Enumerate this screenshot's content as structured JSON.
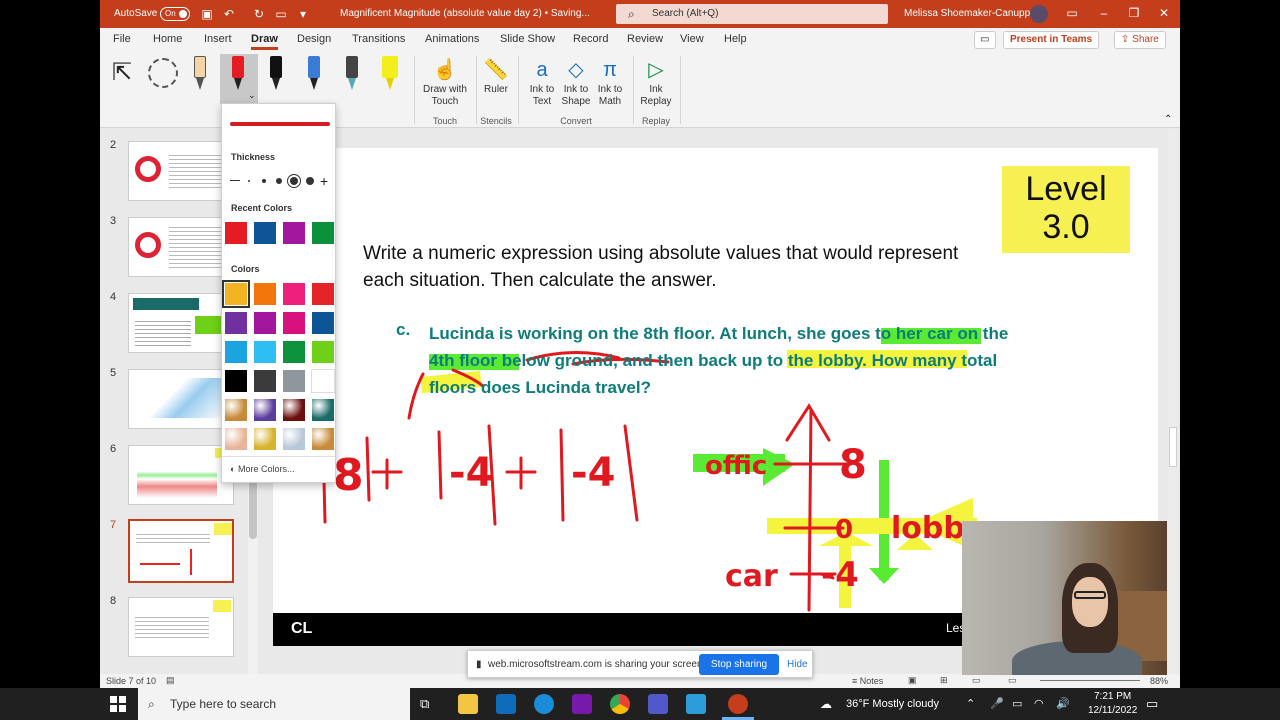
{
  "titlebar": {
    "autosave": "AutoSave",
    "autosave_state": "On",
    "doc_title": "Magnificent Magnitude (absolute value day 2) • Saving...",
    "search_placeholder": "Search (Alt+Q)",
    "user": "Melissa Shoemaker-Canupp"
  },
  "menu": {
    "tabs": [
      "File",
      "Home",
      "Insert",
      "Draw",
      "Design",
      "Transitions",
      "Animations",
      "Slide Show",
      "Record",
      "Review",
      "View",
      "Help"
    ],
    "active": "Draw",
    "present": "Present in Teams",
    "share": "Share"
  },
  "ribbon": {
    "draw_with_touch": "Draw with Touch",
    "ruler": "Ruler",
    "ink_to_text": "Ink to Text",
    "ink_to_shape": "Ink to Shape",
    "ink_to_math": "Ink to Math",
    "ink_replay": "Ink Replay",
    "groups": {
      "touch": "Touch",
      "stencils": "Stencils",
      "convert": "Convert",
      "replay": "Replay"
    }
  },
  "dropdown": {
    "thickness": "Thickness",
    "recent": "Recent Colors",
    "colors": "Colors",
    "more": "More Colors...",
    "recent_swatches": [
      "#e51c23",
      "#0d5597",
      "#a3179f",
      "#0b913c"
    ],
    "swatches": [
      "#f4b323",
      "#f3760c",
      "#ef1f7d",
      "#e5242a",
      "#7030a0",
      "#a3179f",
      "#d8117f",
      "#0e5595",
      "#1ba4e0",
      "#2ebef3",
      "#0c913d",
      "#6fd018",
      "#000000",
      "#3b3b3b",
      "#8e979b",
      "#ffffff"
    ],
    "textures": [
      "#c68a3b",
      "#5c3d9e",
      "#6b0f0f",
      "#1a6a67",
      "#e8b59a",
      "#d8b32e",
      "#b9c8d8",
      "#c98a3c"
    ]
  },
  "thumbnails": [
    {
      "num": "2"
    },
    {
      "num": "3"
    },
    {
      "num": "4"
    },
    {
      "num": "5"
    },
    {
      "num": "6"
    },
    {
      "num": "7"
    },
    {
      "num": "8"
    }
  ],
  "slide": {
    "level": "Level 3.0",
    "prompt": "Write a numeric expression using absolute values that would represent each situation. Then calculate the answer.",
    "item_letter": "c.",
    "question": "Lucinda is working on the 8th floor. At lunch, she goes to her car on the 4th floor below ground, and then back up to the lobby. How many total floors does Lucinda travel?",
    "footer_logo": "CL",
    "footer_right": "Les"
  },
  "ink_labels": {
    "office": "offic",
    "car": "car",
    "lobby": "lobby",
    "eight": "8",
    "zero": "0",
    "neg4": "-4"
  },
  "status": {
    "slide_info": "Slide 7 of 10",
    "notes": "Notes",
    "zoom": "88%"
  },
  "banner": {
    "message": "web.microsoftstream.com is sharing your screen.",
    "stop": "Stop sharing",
    "hide": "Hide"
  },
  "taskbar": {
    "search": "Type here to search",
    "weather": "36°F  Mostly cloudy",
    "time": "7:21 PM",
    "date": "12/11/2022"
  }
}
